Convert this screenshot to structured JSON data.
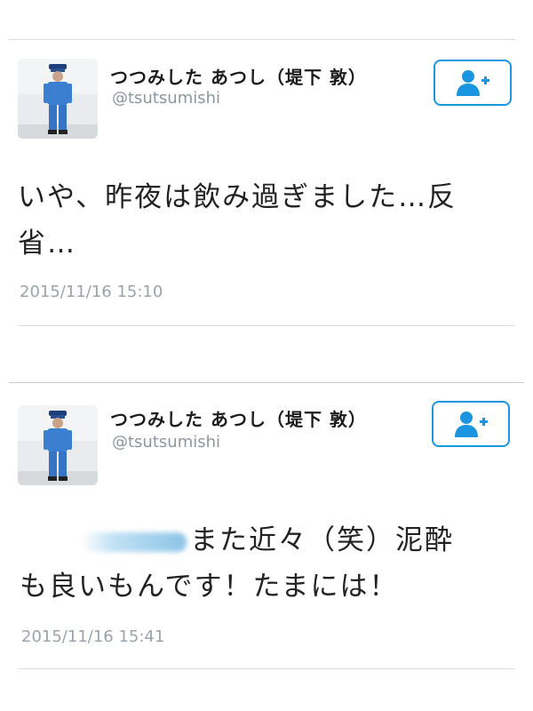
{
  "tweets": [
    {
      "user": {
        "display_name": "つつみした あつし（堤下 敦）",
        "handle": "@tsutsumishi",
        "avatar_icon": "profile-photo-uniform"
      },
      "follow_icon": "add-user-icon",
      "text_lines": [
        "いや、昨夜は飲み過ぎました…反",
        "省…"
      ],
      "timestamp": "2015/11/16 15:10"
    },
    {
      "user": {
        "display_name": "つつみした あつし（堤下 敦）",
        "handle": "@tsutsumishi",
        "avatar_icon": "profile-photo-uniform"
      },
      "follow_icon": "add-user-icon",
      "text_lines": [
        "また近々（笑）泥酔",
        "も良いもんです！たまには！"
      ],
      "timestamp": "2015/11/16 15:41"
    }
  ],
  "colors": {
    "accent": "#1b95e0",
    "divider": "#d9dde1",
    "muted_text": "#8c96a1"
  }
}
